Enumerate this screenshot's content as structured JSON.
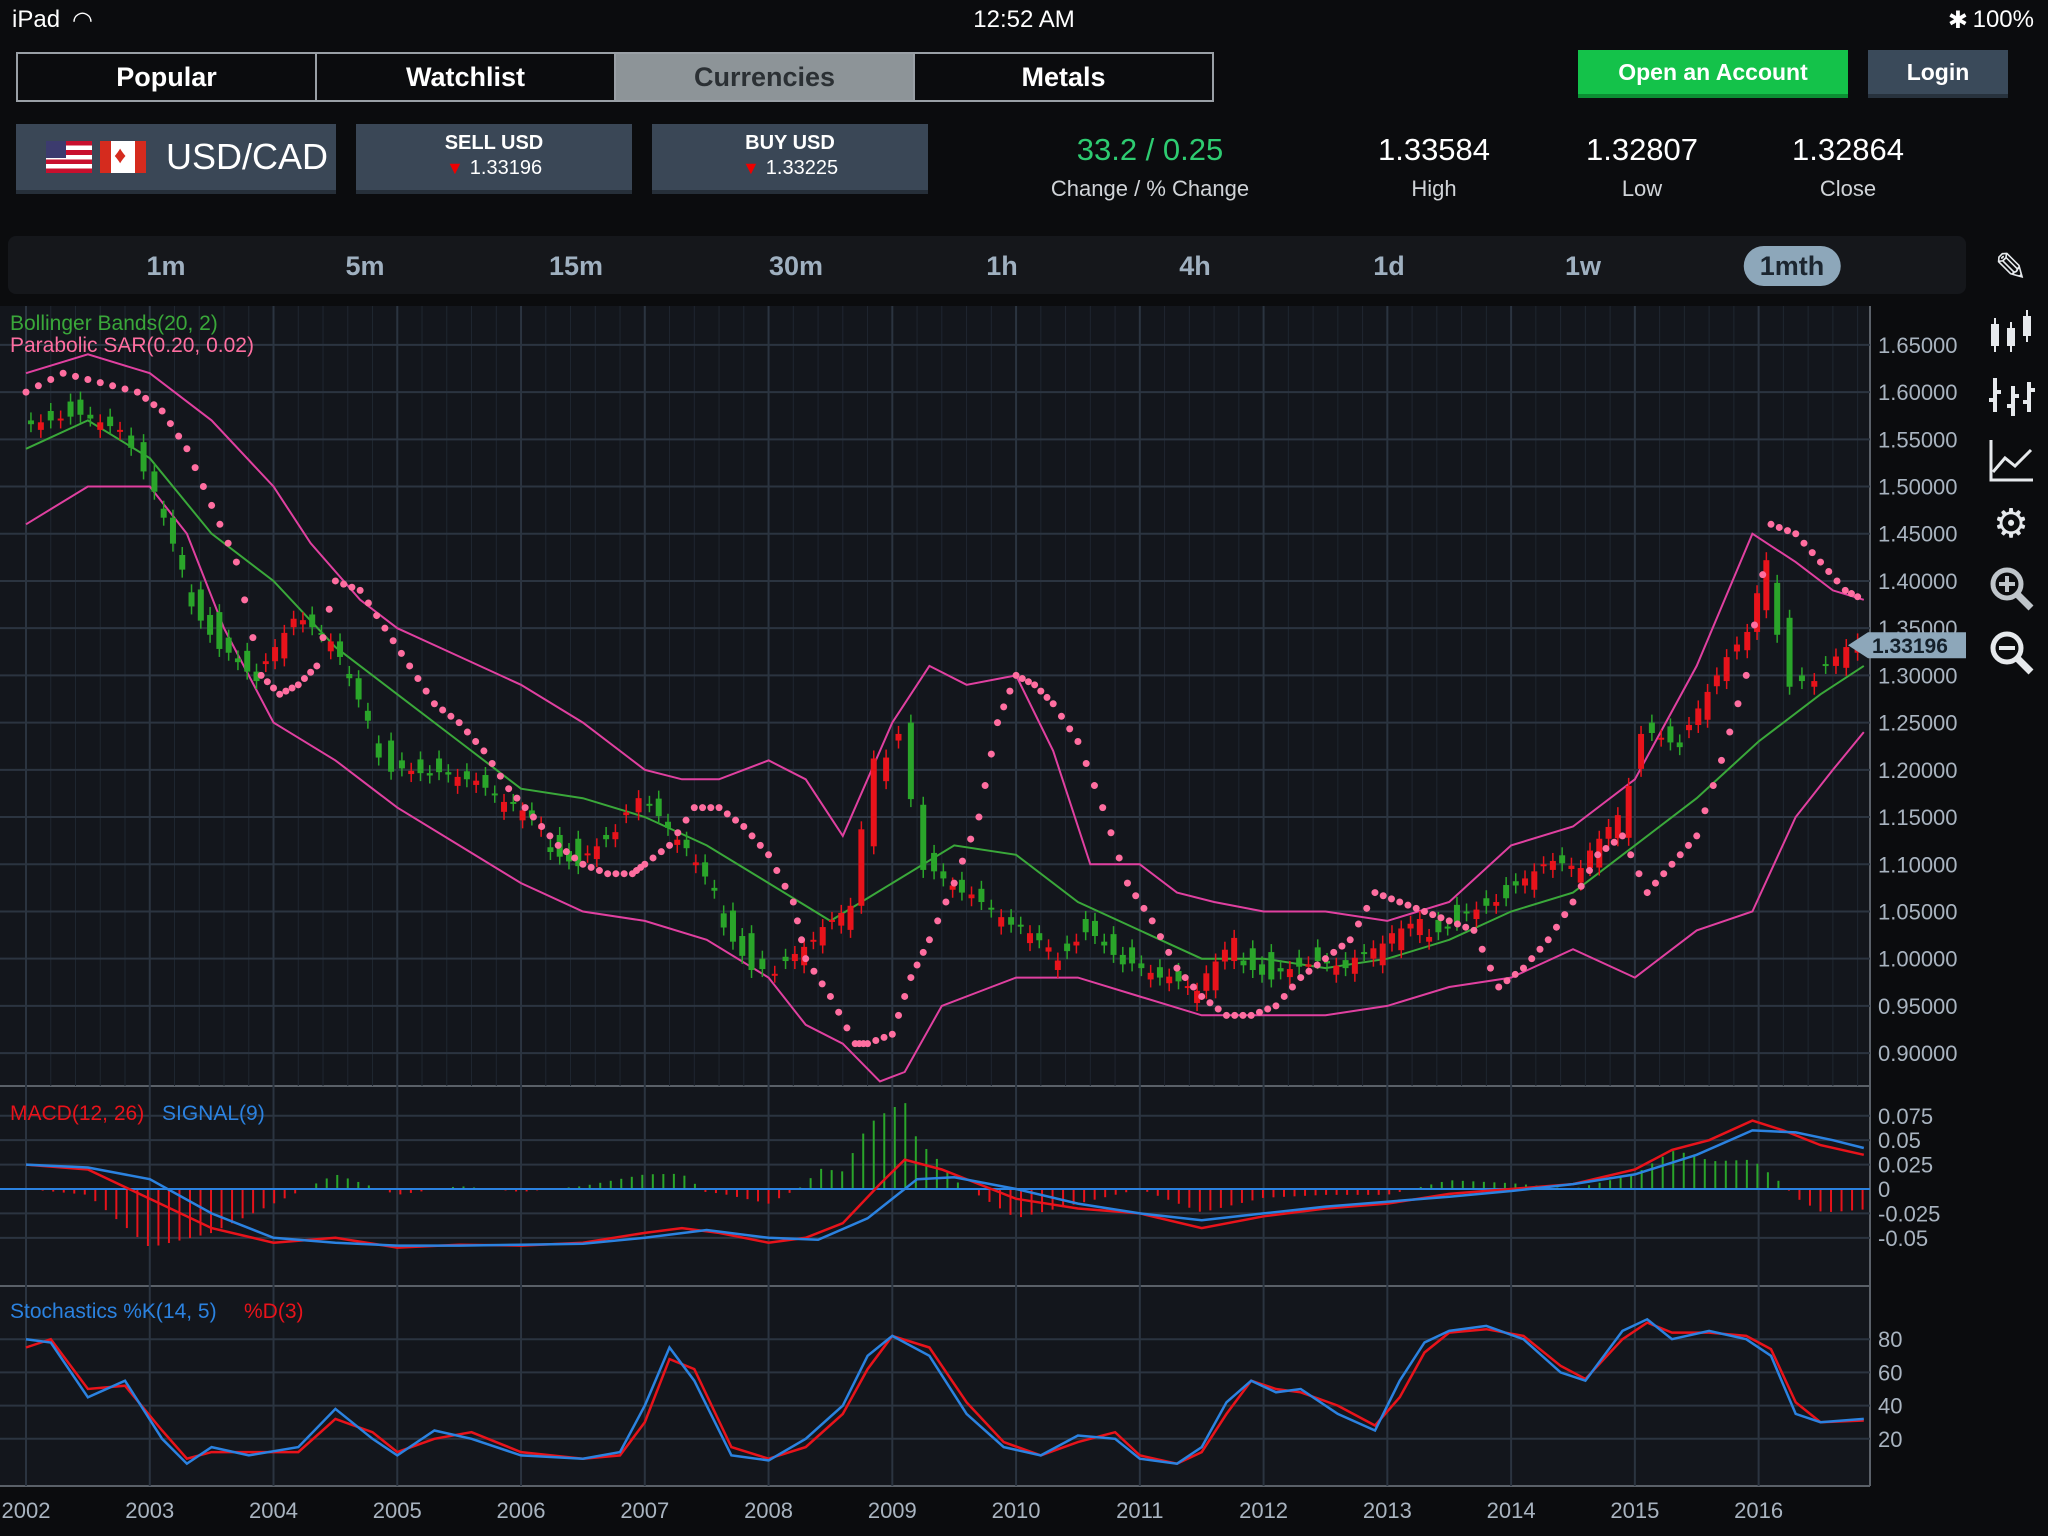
{
  "status": {
    "device": "iPad",
    "time": "12:52 AM",
    "battery": "100%"
  },
  "tabs": [
    "Popular",
    "Watchlist",
    "Currencies",
    "Metals"
  ],
  "active_tab": "Currencies",
  "account": {
    "open": "Open an Account",
    "login": "Login"
  },
  "pair": {
    "label": "USD/CAD"
  },
  "sell": {
    "label": "SELL USD",
    "price": "1.33196"
  },
  "buy": {
    "label": "BUY USD",
    "price": "1.33225"
  },
  "stats": {
    "change": {
      "value": "33.2 / 0.25",
      "label": "Change / % Change",
      "color": "#2ecc71"
    },
    "high": {
      "value": "1.33584",
      "label": "High"
    },
    "low": {
      "value": "1.32807",
      "label": "Low"
    },
    "close": {
      "value": "1.32864",
      "label": "Close"
    }
  },
  "timeframes": [
    "1m",
    "5m",
    "15m",
    "30m",
    "1h",
    "4h",
    "1d",
    "1w",
    "1mth"
  ],
  "active_timeframe": "1mth",
  "tools": [
    "pencil-icon",
    "candlestick-icon",
    "ohlc-icon",
    "line-chart-icon",
    "settings-icon",
    "zoom-in-icon",
    "zoom-out-icon"
  ],
  "chart_data": {
    "type": "line",
    "x": [
      2002,
      2003,
      2004,
      2005,
      2006,
      2007,
      2008,
      2009,
      2010,
      2011,
      2012,
      2013,
      2014,
      2015,
      2016
    ],
    "xlim": [
      2002,
      2016.9
    ],
    "indicators": {
      "bollinger": "Bollinger Bands(20, 2)",
      "sar": "Parabolic SAR(0.20, 0.02)",
      "macd": "MACD(12, 26)",
      "signal": "SIGNAL(9)",
      "stoch": "Stochastics %K(14, 5)",
      "stoch_d": "%D(3)"
    },
    "price": {
      "ylim": [
        0.88,
        1.67
      ],
      "ticks": [
        "1.65000",
        "1.60000",
        "1.55000",
        "1.50000",
        "1.45000",
        "1.40000",
        "1.35000",
        "1.30000",
        "1.25000",
        "1.20000",
        "1.15000",
        "1.10000",
        "1.05000",
        "1.00000",
        "0.95000",
        "0.90000"
      ],
      "current": "1.33196",
      "series": [
        {
          "name": "USD/CAD",
          "color": "#2aa52a",
          "x": [
            2002.0,
            2002.4,
            2002.8,
            2003.0,
            2003.3,
            2003.6,
            2003.9,
            2004.2,
            2004.5,
            2004.8,
            2005.0,
            2005.3,
            2005.6,
            2005.9,
            2006.2,
            2006.5,
            2006.8,
            2007.0,
            2007.3,
            2007.6,
            2007.9,
            2008.1,
            2008.4,
            2008.7,
            2008.9,
            2009.1,
            2009.3,
            2009.6,
            2010.0,
            2010.3,
            2010.6,
            2010.9,
            2011.2,
            2011.5,
            2011.8,
            2012.1,
            2012.4,
            2012.7,
            2013.0,
            2013.3,
            2013.6,
            2014.0,
            2014.3,
            2014.6,
            2014.9,
            2015.1,
            2015.4,
            2015.7,
            2015.95,
            2016.1,
            2016.3,
            2016.5,
            2016.75,
            2016.85
          ],
          "y": [
            1.57,
            1.58,
            1.56,
            1.51,
            1.4,
            1.34,
            1.3,
            1.36,
            1.33,
            1.24,
            1.21,
            1.2,
            1.19,
            1.16,
            1.13,
            1.11,
            1.14,
            1.17,
            1.12,
            1.06,
            1.0,
            0.99,
            1.02,
            1.05,
            1.2,
            1.25,
            1.1,
            1.07,
            1.03,
            1.0,
            1.04,
            1.0,
            0.98,
            0.96,
            1.01,
            0.99,
            1.0,
            0.99,
            1.01,
            1.03,
            1.05,
            1.07,
            1.1,
            1.09,
            1.14,
            1.25,
            1.23,
            1.3,
            1.34,
            1.41,
            1.3,
            1.3,
            1.33,
            1.33
          ]
        },
        {
          "name": "Bollinger Middle",
          "color": "#3aa83a",
          "x": [
            2002.0,
            2002.5,
            2003.0,
            2003.5,
            2004.0,
            2004.5,
            2005.0,
            2005.5,
            2006.0,
            2006.5,
            2007.0,
            2007.5,
            2008.0,
            2008.5,
            2009.0,
            2009.5,
            2010.0,
            2010.5,
            2011.0,
            2011.5,
            2012.0,
            2012.5,
            2013.0,
            2013.5,
            2014.0,
            2014.5,
            2015.0,
            2015.5,
            2016.0,
            2016.5,
            2016.85
          ],
          "y": [
            1.54,
            1.57,
            1.53,
            1.45,
            1.4,
            1.33,
            1.28,
            1.23,
            1.18,
            1.17,
            1.15,
            1.12,
            1.08,
            1.04,
            1.08,
            1.12,
            1.11,
            1.06,
            1.03,
            1.0,
            1.0,
            0.99,
            1.0,
            1.02,
            1.05,
            1.07,
            1.12,
            1.17,
            1.23,
            1.28,
            1.31
          ]
        },
        {
          "name": "Bollinger Upper",
          "color": "#e040a0",
          "x": [
            2002.0,
            2002.5,
            2003.0,
            2003.5,
            2004.0,
            2004.3,
            2004.7,
            2005.0,
            2005.5,
            2006.0,
            2006.5,
            2007.0,
            2007.3,
            2007.6,
            2008.0,
            2008.3,
            2008.6,
            2009.0,
            2009.3,
            2009.6,
            2010.0,
            2010.3,
            2010.6,
            2011.0,
            2011.3,
            2011.6,
            2012.0,
            2012.5,
            2013.0,
            2013.5,
            2014.0,
            2014.5,
            2015.0,
            2015.5,
            2015.95,
            2016.3,
            2016.6,
            2016.85
          ],
          "y": [
            1.62,
            1.64,
            1.62,
            1.57,
            1.5,
            1.44,
            1.38,
            1.35,
            1.32,
            1.29,
            1.25,
            1.2,
            1.19,
            1.19,
            1.21,
            1.19,
            1.13,
            1.25,
            1.31,
            1.29,
            1.3,
            1.22,
            1.1,
            1.1,
            1.07,
            1.06,
            1.05,
            1.05,
            1.04,
            1.06,
            1.12,
            1.14,
            1.19,
            1.31,
            1.45,
            1.42,
            1.39,
            1.38
          ]
        },
        {
          "name": "Bollinger Lower",
          "color": "#e040a0",
          "x": [
            2002.0,
            2002.5,
            2003.0,
            2003.3,
            2003.6,
            2004.0,
            2004.5,
            2005.0,
            2005.5,
            2006.0,
            2006.5,
            2007.0,
            2007.5,
            2008.0,
            2008.3,
            2008.6,
            2008.9,
            2009.1,
            2009.4,
            2009.8,
            2010.0,
            2010.5,
            2011.0,
            2011.5,
            2012.0,
            2012.5,
            2013.0,
            2013.5,
            2014.0,
            2014.5,
            2015.0,
            2015.5,
            2015.95,
            2016.3,
            2016.6,
            2016.85
          ],
          "y": [
            1.46,
            1.5,
            1.5,
            1.45,
            1.35,
            1.25,
            1.21,
            1.16,
            1.12,
            1.08,
            1.05,
            1.04,
            1.02,
            0.98,
            0.93,
            0.91,
            0.87,
            0.88,
            0.95,
            0.97,
            0.98,
            0.98,
            0.96,
            0.94,
            0.94,
            0.94,
            0.95,
            0.97,
            0.98,
            1.01,
            0.98,
            1.03,
            1.05,
            1.15,
            1.2,
            1.24
          ]
        },
        {
          "name": "Parabolic SAR",
          "color": "#ff6ea0",
          "x": [
            2002.0,
            2002.3,
            2002.6,
            2002.9,
            2003.1,
            2003.3,
            2003.5,
            2003.7,
            2003.9,
            2004.05,
            2004.2,
            2004.35,
            2004.5,
            2004.7,
            2004.9,
            2005.1,
            2005.3,
            2005.5,
            2005.7,
            2005.9,
            2006.1,
            2006.3,
            2006.5,
            2006.7,
            2006.9,
            2007.0,
            2007.2,
            2007.4,
            2007.6,
            2007.8,
            2008.0,
            2008.2,
            2008.3,
            2008.5,
            2008.7,
            2008.8,
            2009.0,
            2009.15,
            2009.3,
            2009.5,
            2009.7,
            2009.85,
            2010.0,
            2010.15,
            2010.3,
            2010.5,
            2010.7,
            2010.9,
            2011.1,
            2011.3,
            2011.5,
            2011.7,
            2011.9,
            2012.1,
            2012.3,
            2012.5,
            2012.7,
            2012.9,
            2013.1,
            2013.3,
            2013.5,
            2013.7,
            2013.9,
            2014.1,
            2014.3,
            2014.5,
            2014.7,
            2014.9,
            2015.1,
            2015.3,
            2015.5,
            2015.7,
            2015.9,
            2016.1,
            2016.3,
            2016.5,
            2016.7,
            2016.85
          ],
          "y": [
            1.6,
            1.62,
            1.61,
            1.6,
            1.58,
            1.54,
            1.48,
            1.42,
            1.3,
            1.28,
            1.29,
            1.31,
            1.4,
            1.39,
            1.35,
            1.31,
            1.27,
            1.25,
            1.22,
            1.18,
            1.15,
            1.12,
            1.1,
            1.09,
            1.09,
            1.1,
            1.12,
            1.16,
            1.16,
            1.14,
            1.11,
            1.06,
            1.0,
            0.96,
            0.91,
            0.91,
            0.92,
            0.98,
            1.02,
            1.08,
            1.15,
            1.25,
            1.3,
            1.29,
            1.27,
            1.23,
            1.16,
            1.08,
            1.04,
            0.99,
            0.96,
            0.94,
            0.94,
            0.95,
            0.98,
            1.0,
            1.02,
            1.07,
            1.06,
            1.05,
            1.04,
            1.03,
            0.97,
            0.99,
            1.02,
            1.06,
            1.11,
            1.13,
            1.07,
            1.1,
            1.13,
            1.21,
            1.3,
            1.46,
            1.45,
            1.42,
            1.39,
            1.38
          ]
        }
      ]
    },
    "macd": {
      "ylim": [
        -0.085,
        0.085
      ],
      "ticks": [
        "0.075",
        "0.05",
        "0.025",
        "0",
        "-0.025",
        "-0.05"
      ],
      "series": [
        {
          "name": "MACD",
          "color": "#e8131b",
          "x": [
            2002.0,
            2002.5,
            2003.0,
            2003.5,
            2004.0,
            2004.5,
            2005.0,
            2005.5,
            2006.0,
            2006.5,
            2007.0,
            2007.3,
            2007.6,
            2008.0,
            2008.3,
            2008.6,
            2008.9,
            2009.1,
            2009.4,
            2009.8,
            2010.0,
            2010.5,
            2011.0,
            2011.5,
            2012.0,
            2012.5,
            2013.0,
            2013.5,
            2014.0,
            2014.5,
            2015.0,
            2015.3,
            2015.6,
            2015.95,
            2016.2,
            2016.5,
            2016.85
          ],
          "y": [
            0.025,
            0.02,
            -0.01,
            -0.04,
            -0.055,
            -0.05,
            -0.06,
            -0.057,
            -0.058,
            -0.055,
            -0.045,
            -0.04,
            -0.045,
            -0.055,
            -0.05,
            -0.035,
            0.005,
            0.03,
            0.02,
            0.0,
            -0.01,
            -0.02,
            -0.025,
            -0.04,
            -0.028,
            -0.02,
            -0.015,
            -0.005,
            0.0,
            0.005,
            0.02,
            0.04,
            0.05,
            0.07,
            0.06,
            0.045,
            0.035
          ]
        },
        {
          "name": "SIGNAL",
          "color": "#2b82e0",
          "x": [
            2002.0,
            2002.5,
            2003.0,
            2003.5,
            2004.0,
            2004.5,
            2005.0,
            2005.5,
            2006.0,
            2006.5,
            2007.0,
            2007.5,
            2008.0,
            2008.4,
            2008.8,
            2009.2,
            2009.5,
            2010.0,
            2010.5,
            2011.0,
            2011.5,
            2012.0,
            2012.5,
            2013.0,
            2013.5,
            2014.0,
            2014.5,
            2015.0,
            2015.5,
            2015.95,
            2016.3,
            2016.6,
            2016.85
          ],
          "y": [
            0.025,
            0.022,
            0.01,
            -0.025,
            -0.05,
            -0.055,
            -0.058,
            -0.058,
            -0.057,
            -0.056,
            -0.05,
            -0.042,
            -0.05,
            -0.052,
            -0.03,
            0.01,
            0.012,
            0.0,
            -0.015,
            -0.025,
            -0.032,
            -0.025,
            -0.018,
            -0.013,
            -0.008,
            -0.002,
            0.005,
            0.015,
            0.035,
            0.06,
            0.058,
            0.05,
            0.042
          ]
        }
      ]
    },
    "stochastics": {
      "ylim": [
        0,
        100
      ],
      "ticks": [
        "80",
        "60",
        "40",
        "20"
      ],
      "series": [
        {
          "name": "%K",
          "color": "#2b82e0",
          "x": [
            2002.0,
            2002.2,
            2002.5,
            2002.8,
            2003.1,
            2003.3,
            2003.5,
            2003.8,
            2004.2,
            2004.5,
            2004.8,
            2005.0,
            2005.3,
            2005.6,
            2006.0,
            2006.5,
            2006.8,
            2007.0,
            2007.2,
            2007.4,
            2007.7,
            2008.0,
            2008.3,
            2008.6,
            2008.8,
            2009.0,
            2009.3,
            2009.6,
            2009.9,
            2010.2,
            2010.5,
            2010.8,
            2011.0,
            2011.3,
            2011.5,
            2011.7,
            2011.9,
            2012.1,
            2012.3,
            2012.6,
            2012.9,
            2013.1,
            2013.3,
            2013.5,
            2013.8,
            2014.1,
            2014.4,
            2014.6,
            2014.9,
            2015.1,
            2015.3,
            2015.6,
            2015.9,
            2016.1,
            2016.3,
            2016.5,
            2016.85
          ],
          "y": [
            80,
            78,
            45,
            55,
            20,
            5,
            15,
            10,
            15,
            38,
            20,
            10,
            25,
            20,
            10,
            8,
            12,
            40,
            75,
            55,
            10,
            7,
            20,
            40,
            70,
            82,
            70,
            35,
            15,
            10,
            22,
            20,
            8,
            5,
            15,
            42,
            55,
            48,
            50,
            35,
            25,
            55,
            78,
            85,
            88,
            80,
            60,
            55,
            85,
            92,
            80,
            85,
            80,
            70,
            35,
            30,
            32
          ]
        },
        {
          "name": "%D",
          "color": "#e8131b",
          "x": [
            2002.0,
            2002.2,
            2002.5,
            2002.8,
            2003.1,
            2003.3,
            2003.5,
            2003.8,
            2004.2,
            2004.5,
            2004.8,
            2005.0,
            2005.3,
            2005.6,
            2006.0,
            2006.5,
            2006.8,
            2007.0,
            2007.2,
            2007.4,
            2007.7,
            2008.0,
            2008.3,
            2008.6,
            2008.8,
            2009.0,
            2009.3,
            2009.6,
            2009.9,
            2010.2,
            2010.5,
            2010.8,
            2011.0,
            2011.3,
            2011.5,
            2011.7,
            2011.9,
            2012.1,
            2012.3,
            2012.6,
            2012.9,
            2013.1,
            2013.3,
            2013.5,
            2013.8,
            2014.1,
            2014.4,
            2014.6,
            2014.9,
            2015.1,
            2015.3,
            2015.6,
            2015.9,
            2016.1,
            2016.3,
            2016.5,
            2016.85
          ],
          "y": [
            75,
            80,
            50,
            52,
            25,
            8,
            12,
            12,
            12,
            32,
            24,
            12,
            20,
            24,
            12,
            8,
            10,
            30,
            68,
            62,
            15,
            8,
            15,
            35,
            62,
            82,
            75,
            42,
            18,
            10,
            18,
            24,
            10,
            5,
            12,
            35,
            55,
            50,
            48,
            40,
            28,
            45,
            72,
            84,
            86,
            82,
            64,
            56,
            80,
            90,
            84,
            84,
            82,
            74,
            42,
            30,
            31
          ]
        }
      ]
    }
  }
}
